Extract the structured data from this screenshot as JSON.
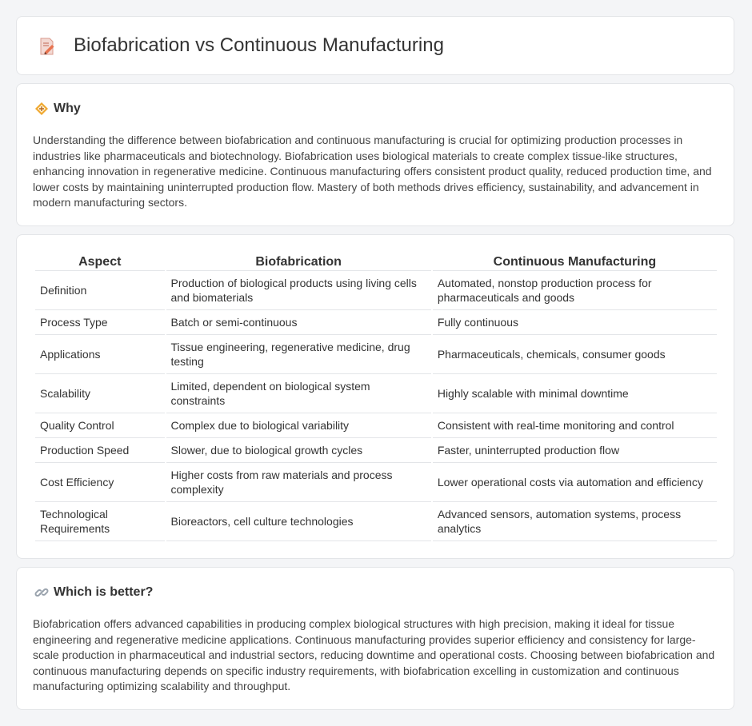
{
  "title": "Biofabrication vs Continuous Manufacturing",
  "why": {
    "heading": "Why",
    "body": "Understanding the difference between biofabrication and continuous manufacturing is crucial for optimizing production processes in industries like pharmaceuticals and biotechnology. Biofabrication uses biological materials to create complex tissue-like structures, enhancing innovation in regenerative medicine. Continuous manufacturing offers consistent product quality, reduced production time, and lower costs by maintaining uninterrupted production flow. Mastery of both methods drives efficiency, sustainability, and advancement in modern manufacturing sectors."
  },
  "table": {
    "headers": [
      "Aspect",
      "Biofabrication",
      "Continuous Manufacturing"
    ],
    "rows": [
      [
        "Definition",
        "Production of biological products using living cells and biomaterials",
        "Automated, nonstop production process for pharmaceuticals and goods"
      ],
      [
        "Process Type",
        "Batch or semi-continuous",
        "Fully continuous"
      ],
      [
        "Applications",
        "Tissue engineering, regenerative medicine, drug testing",
        "Pharmaceuticals, chemicals, consumer goods"
      ],
      [
        "Scalability",
        "Limited, dependent on biological system constraints",
        "Highly scalable with minimal downtime"
      ],
      [
        "Quality Control",
        "Complex due to biological variability",
        "Consistent with real-time monitoring and control"
      ],
      [
        "Production Speed",
        "Slower, due to biological growth cycles",
        "Faster, uninterrupted production flow"
      ],
      [
        "Cost Efficiency",
        "Higher costs from raw materials and process complexity",
        "Lower operational costs via automation and efficiency"
      ],
      [
        "Technological Requirements",
        "Bioreactors, cell culture technologies",
        "Advanced sensors, automation systems, process analytics"
      ]
    ]
  },
  "better": {
    "heading": "Which is better?",
    "body": "Biofabrication offers advanced capabilities in producing complex biological structures with high precision, making it ideal for tissue engineering and regenerative medicine applications. Continuous manufacturing provides superior efficiency and consistency for large-scale production in pharmaceutical and industrial sectors, reducing downtime and operational costs. Choosing between biofabrication and continuous manufacturing depends on specific industry requirements, with biofabrication excelling in customization and continuous manufacturing optimizing scalability and throughput."
  },
  "icons": {
    "title": "document-pencil-icon",
    "why": "diamond-sign-icon",
    "better": "link-icon"
  }
}
